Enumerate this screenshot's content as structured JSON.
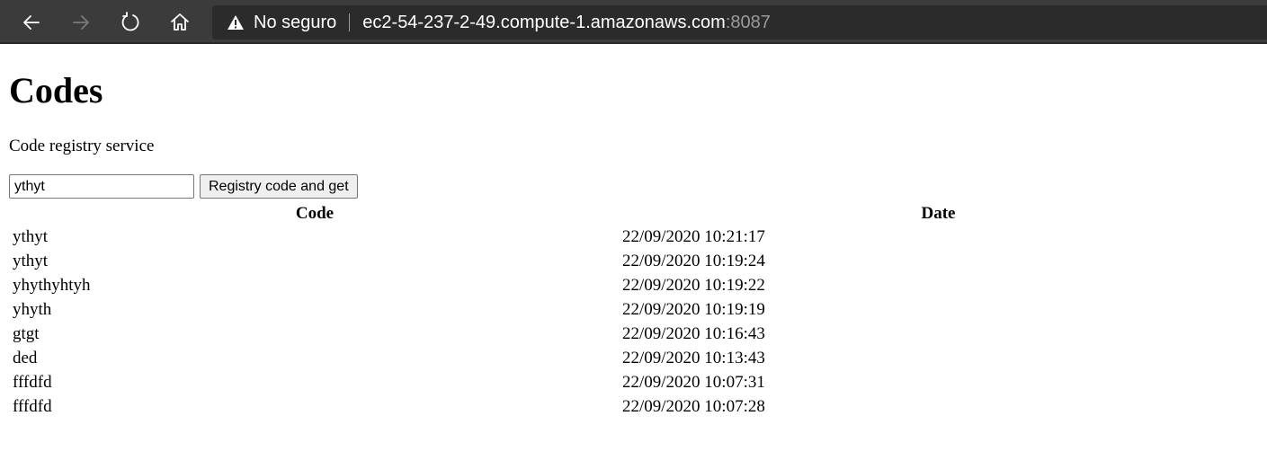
{
  "browser": {
    "security_label": "No seguro",
    "url_host": "ec2-54-237-2-49.compute-1.amazonaws.com",
    "url_port": ":8087",
    "icons": [
      "back-arrow-icon",
      "forward-arrow-icon",
      "refresh-icon",
      "home-icon",
      "warning-icon"
    ]
  },
  "page": {
    "title": "Codes",
    "subtitle": "Code registry service",
    "input_value": "ythyt",
    "submit_label": "Registry code and get",
    "table": {
      "headers": [
        "Code",
        "Date"
      ],
      "rows": [
        [
          "ythyt",
          "22/09/2020 10:21:17"
        ],
        [
          "ythyt",
          "22/09/2020 10:19:24"
        ],
        [
          "yhythyhtyh",
          "22/09/2020 10:19:22"
        ],
        [
          "yhyth",
          "22/09/2020 10:19:19"
        ],
        [
          "gtgt",
          "22/09/2020 10:16:43"
        ],
        [
          "ded",
          "22/09/2020 10:13:43"
        ],
        [
          "fffdfd",
          "22/09/2020 10:07:31"
        ],
        [
          "fffdfd",
          "22/09/2020 10:07:28"
        ]
      ]
    }
  }
}
